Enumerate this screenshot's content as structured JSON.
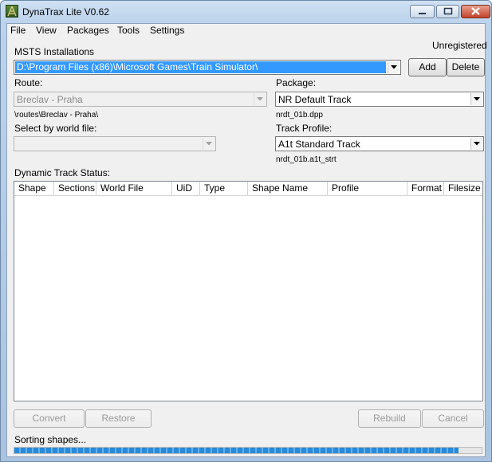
{
  "window": {
    "title": "DynaTrax Lite V0.62"
  },
  "menu": [
    "File",
    "View",
    "Packages",
    "Tools",
    "Settings"
  ],
  "registration_status": "Unregistered",
  "msts": {
    "label": "MSTS Installations",
    "selected": "D:\\Program Files (x86)\\Microsoft Games\\Train Simulator\\",
    "add_label": "Add",
    "delete_label": "Delete"
  },
  "route": {
    "label": "Route:",
    "selected": "Breclav - Praha",
    "path": "\\routes\\Breclav - Praha\\"
  },
  "world_file": {
    "label": "Select by world file:",
    "selected": ""
  },
  "package": {
    "label": "Package:",
    "selected": "NR Default Track",
    "file": "nrdt_01b.dpp"
  },
  "track_profile": {
    "label": "Track Profile:",
    "selected": "A1t Standard Track",
    "file": "nrdt_01b.a1t_strt"
  },
  "status_grid": {
    "label": "Dynamic Track Status:",
    "columns": [
      "Shape",
      "Sections",
      "World File",
      "UiD",
      "Type",
      "Shape Name",
      "Profile",
      "Format",
      "Filesize"
    ],
    "rows": []
  },
  "buttons": {
    "convert": "Convert",
    "restore": "Restore",
    "rebuild": "Rebuild",
    "cancel": "Cancel"
  },
  "status_text": "Sorting shapes...",
  "progress": 0.95,
  "icons": {
    "app": "train-track-icon",
    "minimize": "minimize-icon",
    "maximize": "maximize-icon",
    "close": "close-icon",
    "dropdown": "chevron-down-icon"
  }
}
